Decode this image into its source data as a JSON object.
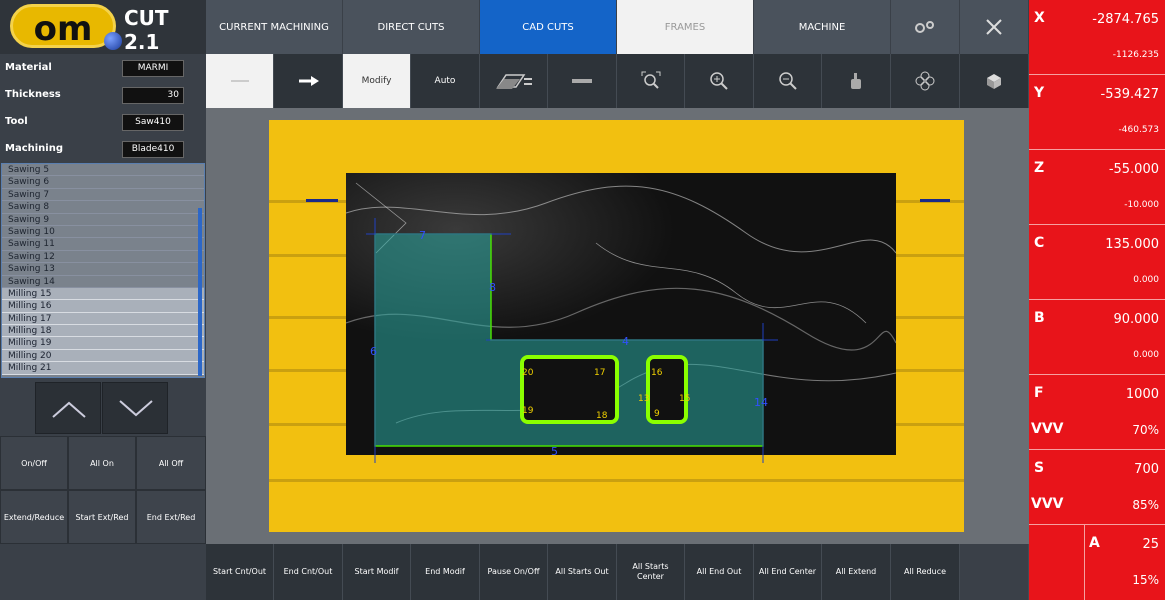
{
  "app": {
    "logo_text": "om",
    "version": "CUT 2.1"
  },
  "tabs": [
    {
      "label": "CURRENT MACHINING"
    },
    {
      "label": "DIRECT CUTS"
    },
    {
      "label": "CAD CUTS"
    },
    {
      "label": "FRAMES"
    },
    {
      "label": "MACHINE"
    }
  ],
  "fields": [
    {
      "label": "Material",
      "value": "MARMI"
    },
    {
      "label": "Thickness",
      "value": "30"
    },
    {
      "label": "Tool",
      "value": "Saw410"
    },
    {
      "label": "Machining",
      "value": "Blade410"
    }
  ],
  "operations": [
    "Sawing 5",
    "Sawing 6",
    "Sawing 7",
    "Sawing 8",
    "Sawing 9",
    "Sawing 10",
    "Sawing 11",
    "Sawing 12",
    "Sawing 13",
    "Sawing 14",
    "Milling 15",
    "Milling 16",
    "Milling 17",
    "Milling 18",
    "Milling 19",
    "Milling 20",
    "Milling 21"
  ],
  "toggle_buttons": [
    {
      "label": "On/Off"
    },
    {
      "label": "All On"
    },
    {
      "label": "All Off"
    },
    {
      "label": "Extend/Reduce"
    },
    {
      "label": "Start Ext/Red"
    },
    {
      "label": "End Ext/Red"
    }
  ],
  "toolbar": {
    "modify_label": "Modify",
    "auto_label": "Auto"
  },
  "bottom_buttons": [
    "Start Cnt/Out",
    "End Cnt/Out",
    "Start Modif",
    "End Modif",
    "Pause On/Off",
    "All Starts Out",
    "All Starts Center",
    "All End Out",
    "All End Center",
    "All Extend",
    "All Reduce"
  ],
  "drawing_labels": [
    "7",
    "8",
    "6",
    "5",
    "4",
    "20",
    "17",
    "16",
    "19",
    "13",
    "15",
    "14",
    "18",
    "9"
  ],
  "axes": [
    {
      "name": "X",
      "main": "-2874.765",
      "sub": "-1126.235"
    },
    {
      "name": "Y",
      "main": "-539.427",
      "sub": "-460.573"
    },
    {
      "name": "Z",
      "main": "-55.000",
      "sub": "-10.000"
    },
    {
      "name": "C",
      "main": "135.000",
      "sub": "0.000"
    },
    {
      "name": "B",
      "main": "90.000",
      "sub": "0.000"
    }
  ],
  "feed": {
    "name": "F",
    "value": "1000",
    "vvv": "VVV",
    "pct": "70%"
  },
  "speed": {
    "name": "S",
    "value": "700",
    "vvv": "VVV",
    "pct": "85%"
  },
  "aux": {
    "name": "A",
    "value": "25",
    "pct": "15%"
  },
  "colors": {
    "accent": "#1464c8",
    "dro": "#e8141a",
    "table": "#f2c010",
    "cut_fill": "#2aa8a0",
    "cut_line": "#49e000"
  },
  "icons": [
    "arrow-right-icon",
    "layers-icon",
    "dash-icon",
    "zoom-fit-icon",
    "zoom-in-icon",
    "zoom-out-icon",
    "hand-icon",
    "flower-icon",
    "cube-icon",
    "gear-icon",
    "close-icon",
    "chevron-up-icon",
    "chevron-down-icon"
  ]
}
